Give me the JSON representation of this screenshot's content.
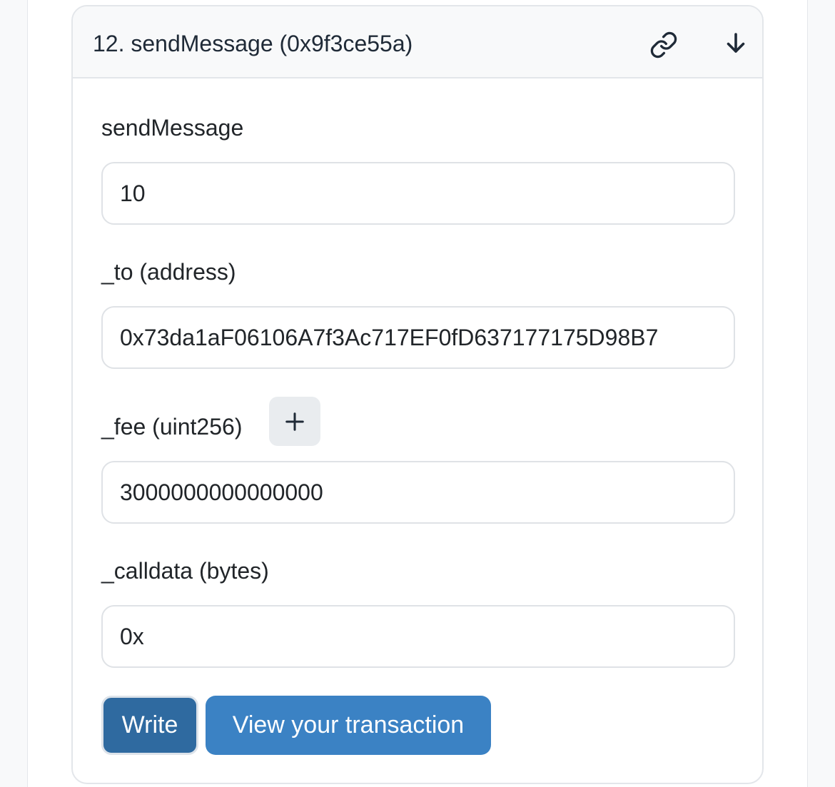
{
  "method": {
    "title": "12. sendMessage (0x9f3ce55a)",
    "link_icon": "link-icon",
    "expand_icon": "arrow-down-icon",
    "payable_label": "sendMessage",
    "payable_value": "10"
  },
  "fields": [
    {
      "label": "_to (address)",
      "value": "0x73da1aF06106A7f3Ac717EF0fD637177175D98B7"
    },
    {
      "label": "_fee (uint256)",
      "value": "3000000000000000",
      "action_icon": "plus-icon"
    },
    {
      "label": "_calldata (bytes)",
      "value": "0x"
    }
  ],
  "actions": {
    "write_label": "Write",
    "view_label": "View your transaction"
  },
  "colors": {
    "write_button": "#2f6aa0",
    "view_button": "#3b82c4",
    "header_background": "#f8f9fa"
  }
}
